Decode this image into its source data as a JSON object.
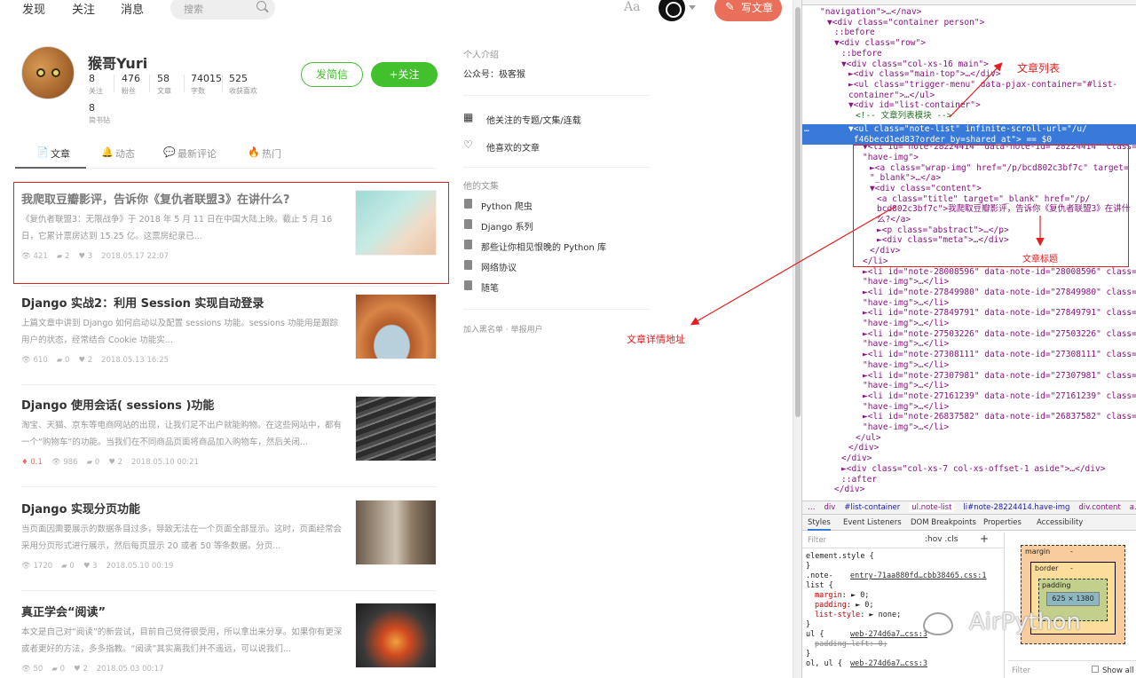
{
  "header": {
    "nav": [
      "发现",
      "关注",
      "消息"
    ],
    "search_placeholder": "搜索",
    "aa": "Aa",
    "write_label": "写文章"
  },
  "profile": {
    "name": "猴哥Yuri",
    "stats": [
      {
        "n": "8",
        "l": "关注"
      },
      {
        "n": "476",
        "l": "粉丝"
      },
      {
        "n": "58",
        "l": "文章"
      },
      {
        "n": "74015",
        "l": "字数"
      },
      {
        "n": "525",
        "l": "收获喜欢"
      }
    ],
    "stat_extra": {
      "n": "8",
      "l": "简书钻"
    },
    "msg_label": "发简信",
    "follow_label": "+关注"
  },
  "tabs": [
    {
      "label": "文章",
      "icon": "📄"
    },
    {
      "label": "动态",
      "icon": "🔔"
    },
    {
      "label": "最新评论",
      "icon": "💬"
    },
    {
      "label": "热门",
      "icon": "🔥"
    }
  ],
  "articles": [
    {
      "title": "我爬取豆瓣影评，告诉你《复仇者联盟3》在讲什么?",
      "abstract": "《复仇者联盟3：无限战争》于 2018 年 5 月 11 日在中国大陆上映。截止 5 月 16 日，它累计票房达到 15.25 亿。这票房纪录已...",
      "views": "421",
      "comments": "2",
      "likes": "3",
      "date": "2018.05.17 22:07",
      "reward": ""
    },
    {
      "title": "Django 实战2：利用 Session 实现自动登录",
      "abstract": "上篇文章中讲到 Django 如何启动以及配置 sessions 功能。sessions 功能用是跟踪用户的状态，经常结合 Cookie 功能实...",
      "views": "610",
      "comments": "0",
      "likes": "2",
      "date": "2018.05.13 16:25",
      "reward": ""
    },
    {
      "title": "Django 使用会话( sessions )功能",
      "abstract": "淘宝、天猫、京东等电商网站的出现，让我们足不出户就能购物。在这些网站中，都有一个“购物车”的功能。当我们在不同商品页面将商品加入购物车，然后关闭...",
      "views": "986",
      "comments": "0",
      "likes": "2",
      "date": "2018.05.10 00:21",
      "reward": "0.1"
    },
    {
      "title": "Django 实现分页功能",
      "abstract": "当页面因需要展示的数据条目过多，导致无法在一个页面全部显示。这时，页面经常会采用分页形式进行展示，然后每页显示 20 或者 50 等条数据。分页...",
      "views": "1720",
      "comments": "0",
      "likes": "3",
      "date": "2018.05.10 00:19",
      "reward": ""
    },
    {
      "title": "真正学会“阅读”",
      "abstract": "本文是自己对“阅读”的新尝试，目前自己觉得很受用，所以拿出来分享。如果你有更深或者更好的方法，多多指教。“阅读”其实离我们并不遥远，可以说我们...",
      "views": "50",
      "comments": "0",
      "likes": "2",
      "date": "2018.05.03 00:17",
      "reward": ""
    }
  ],
  "sidebar": {
    "intro_h": "个人介绍",
    "intro_t": "公众号：极客猴",
    "links": [
      "他关注的专题/文集/连载",
      "他喜欢的文章"
    ],
    "coll_h": "他的文集",
    "collections": [
      "Python 爬虫",
      "Django 系列",
      "那些让你相见恨晚的 Python 库",
      "网络协议",
      "随笔"
    ],
    "footer": "加入黑名单 · 举报用户"
  },
  "annotations": {
    "list": "文章列表",
    "title": "文章标题",
    "url": "文章详情地址"
  },
  "devtools": {
    "lines": [
      [
        0,
        "\"navigation\">…</nav>"
      ],
      [
        1,
        "▼<div class=\"container person\">"
      ],
      [
        2,
        "::before"
      ],
      [
        2,
        "▼<div class=\"row\">"
      ],
      [
        3,
        "::before"
      ],
      [
        3,
        "▼<div class=\"col-xs-16 main\">"
      ],
      [
        4,
        "►<div class=\"main-top\">…</div>"
      ],
      [
        4,
        "►<ul class=\"trigger-menu\" data-pjax-container=\"#list-"
      ],
      [
        4,
        "container\">…</ul>"
      ],
      [
        4,
        "▼<div id=\"list-container\">"
      ],
      [
        5,
        "<!-- 文章列表模块 -->"
      ]
    ],
    "selected": [
      "▼<ul class=\"note-list\" infinite-scroll-url=\"/u/",
      "f46becd1ed83?order_by=shared_at\"> == $0"
    ],
    "boxed": [
      [
        0,
        "▼<li id=\"note-28224414\" data-note-id=\"28224414\" class="
      ],
      [
        0,
        "\"have-img\">"
      ],
      [
        1,
        "►<a class=\"wrap-img\" href=\"/p/bcd802c3bf7c\" target="
      ],
      [
        1,
        "\"_blank\">…</a>"
      ],
      [
        1,
        "▼<div class=\"content\">"
      ],
      [
        2,
        "<a class=\"title\" target=\"_blank\" href=\"/p/"
      ],
      [
        2,
        "bcd802c3bf7c\">我爬取豆瓣影评，告诉你《复仇者联盟3》在讲什"
      ],
      [
        2,
        "么?</a>"
      ],
      [
        2,
        "►<p class=\"abstract\">…</p>"
      ],
      [
        2,
        "►<div class=\"meta\">…</div>"
      ],
      [
        1,
        "</div>"
      ],
      [
        0,
        "</li>"
      ]
    ],
    "notes": [
      [
        "28008596",
        "28008596"
      ],
      [
        "27849980",
        "27849980"
      ],
      [
        "27849791",
        "27849791"
      ],
      [
        "27503226",
        "27503226"
      ],
      [
        "27308111",
        "27308111"
      ],
      [
        "27307981",
        "27307981"
      ],
      [
        "27161239",
        "27161239"
      ],
      [
        "26837582",
        "26837582"
      ]
    ],
    "tail": [
      [
        5,
        "</ul>"
      ],
      [
        4,
        "</div>"
      ],
      [
        3,
        "</div>"
      ],
      [
        3,
        "►<div class=\"col-xs-7 col-xs-offset-1 aside\">…</div>"
      ],
      [
        3,
        "::after"
      ],
      [
        2,
        "</div>"
      ]
    ],
    "crumbs": [
      "…",
      "div",
      "#list-container",
      "ul.note-list",
      "li#note-28224414.have-img",
      "div.content",
      "a.title"
    ],
    "panel_tabs": [
      "Styles",
      "Event Listeners",
      "DOM Breakpoints",
      "Properties",
      "Accessibility"
    ],
    "filter_ph": "Filter",
    "hov": ":hov .cls",
    "styles": [
      {
        "t": "element.style {"
      },
      {
        "t": "}"
      },
      {
        "t": ".note-",
        "lk": "entry-71aa880fd…cbb38465.css:1"
      },
      {
        "t": "list {"
      },
      {
        "p": "margin",
        "v": ": ► 0;"
      },
      {
        "p": "padding",
        "v": ": ► 0;"
      },
      {
        "p": "list-style",
        "v": ": ► none;"
      },
      {
        "t": "}"
      },
      {
        "t": "ul {",
        "lk": "web-274d6a7…css:3"
      },
      {
        "p": "padding-left",
        "v": ": 0;",
        "strike": true
      },
      {
        "t": "}"
      },
      {
        "t": "ol, ul {",
        "lk": "web-274d6a7…css:3"
      }
    ],
    "box": {
      "margin": "margin",
      "border": "border",
      "padding": "padding",
      "content": "625 × 1380",
      "dash": "-"
    },
    "bm_filter": "Filter",
    "show_all": "Show all"
  },
  "watermark": "AirPython"
}
